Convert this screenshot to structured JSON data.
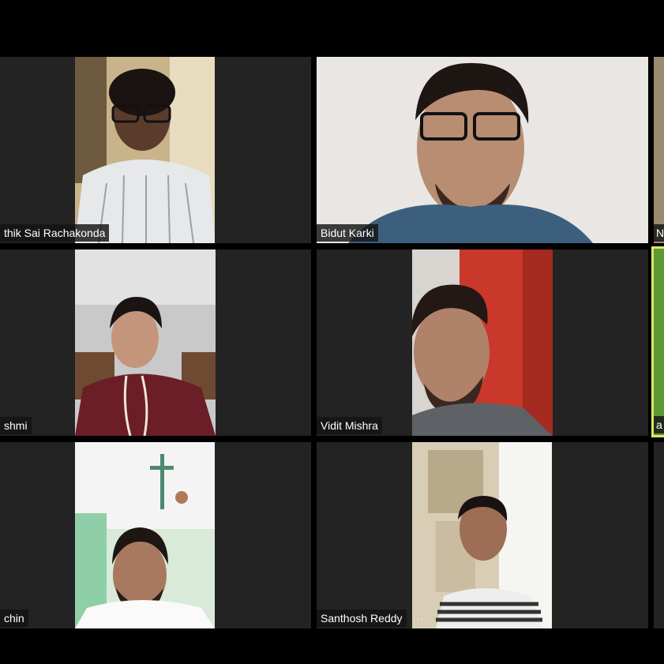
{
  "meeting": {
    "participants": [
      {
        "name": "Karthik Sai Rachakonda",
        "name_visible": "thik Sai Rachakonda"
      },
      {
        "name": "Bidut Karki",
        "name_visible": "Bidut Karki"
      },
      {
        "name": "N",
        "name_visible": "N"
      },
      {
        "name": "Lakshmi",
        "name_visible": "shmi"
      },
      {
        "name": "Vidit Mishra",
        "name_visible": "Vidit Mishra"
      },
      {
        "name": "a",
        "name_visible": "a",
        "speaking": true
      },
      {
        "name": "Sachin",
        "name_visible": "chin"
      },
      {
        "name": "Santhosh Reddy",
        "name_visible": "Santhosh Reddy"
      }
    ],
    "more_options_icon_label": "···",
    "colors": {
      "background": "#000000",
      "tile": "#232323",
      "active_speaker_border": "#e3e36a",
      "nametag_bg": "#141414"
    }
  }
}
